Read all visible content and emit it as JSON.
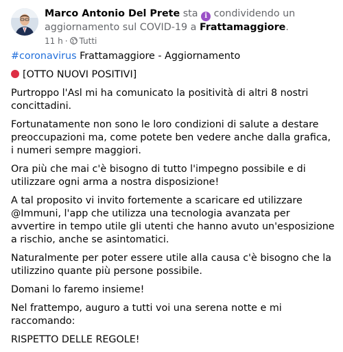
{
  "header": {
    "author": "Marco Antonio Del Prete",
    "activity_prefix": "sta",
    "activity_text": "condividendo un aggiornamento sul COVID-19 a",
    "place": "Frattamaggiore",
    "place_suffix": ".",
    "time": "11 h",
    "audience": "Tutti",
    "activity_icon": "info-icon",
    "audience_icon": "globe-icon"
  },
  "post": {
    "hashtag": "#coronavirus",
    "title_rest": " Frattamaggiore - Aggiornamento",
    "alert": "[OTTO NUOVI POSITIVI]",
    "paragraphs": [
      "Purtroppo l'Asl mi ha comunicato la positività di altri 8 nostri concittadini.",
      "Fortunatamente non sono le loro condizioni di salute a destare preoccupazioni ma, come potete ben vedere anche dalla grafica, i numeri sempre maggiori.",
      "Ora più che mai c'è bisogno di tutto l'impegno possibile e di utilizzare ogni arma a nostra disposizione!",
      "A tal proposito vi invito fortemente a scaricare ed utilizzare @Immuni, l'app che utilizza una tecnologia avanzata per avvertire in tempo utile gli utenti che hanno avuto un'esposizione a rischio, anche se asintomatici.",
      "Naturalmente per poter essere utile alla causa c'è bisogno che la utilizzino quante più persone possibile.",
      "Domani lo faremo insieme!",
      "Nel frattempo, auguro a tutti voi una serena notte e mi raccomando:",
      "RISPETTO DELLE REGOLE!"
    ],
    "colors": {
      "hashtag": "#216fdb",
      "alert_dot": "#dd2e44",
      "activity_icon": "#9b51c7"
    }
  }
}
